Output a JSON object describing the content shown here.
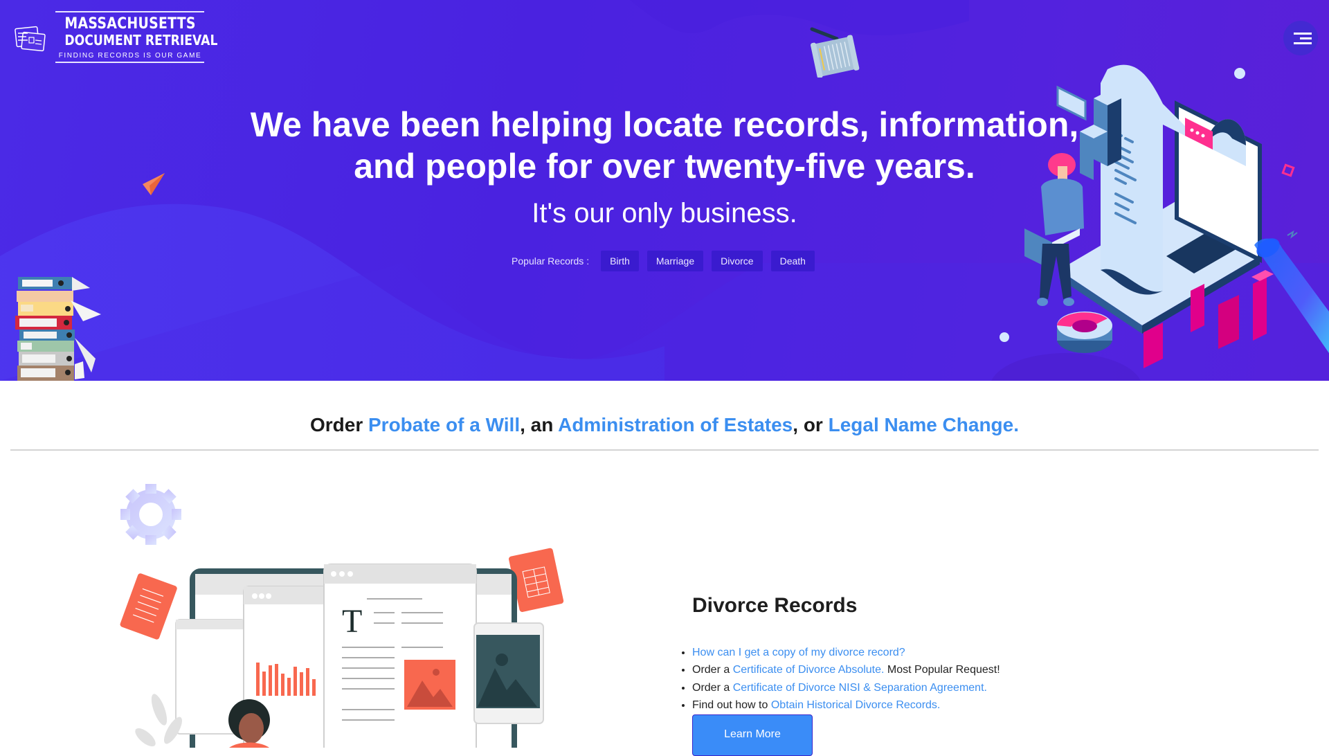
{
  "header": {
    "logo": {
      "line1": "MASSACHUSETTS",
      "line2": "DOCUMENT RETRIEVAL",
      "tagline": "FINDING RECORDS IS OUR GAME"
    },
    "menu_icon": "hamburger-menu-icon"
  },
  "hero": {
    "headline_line1": "We have been helping locate records, information,",
    "headline_line2": "and people for over twenty-five years.",
    "subheadline": "It's our only business.",
    "popular_label": "Popular Records :",
    "popular_records": [
      {
        "label": "Birth"
      },
      {
        "label": "Marriage"
      },
      {
        "label": "Divorce"
      },
      {
        "label": "Death"
      }
    ],
    "colors": {
      "background": "#4b24e2",
      "button_bg": "#3a1bcf"
    }
  },
  "order_banner": {
    "prefix": "Order ",
    "link1": "Probate of a Will",
    "sep1": ", an ",
    "link2": "Administration of Estates",
    "sep2": ", or ",
    "link3": "Legal Name Change."
  },
  "divorce_section": {
    "title": "Divorce Records",
    "items": [
      {
        "prefix": "",
        "link": "How can I get a copy of my divorce record?",
        "suffix": ""
      },
      {
        "prefix": "Order a ",
        "link": "Certificate of Divorce Absolute.",
        "suffix": " Most Popular Request!"
      },
      {
        "prefix": "Order a ",
        "link": "Certificate of Divorce NISI & Separation Agreement.",
        "suffix": ""
      },
      {
        "prefix": "Find out how to ",
        "link": "Obtain Historical Divorce Records.",
        "suffix": ""
      }
    ],
    "button_label": "Learn More",
    "colors": {
      "link": "#3b8ef0",
      "button": "#3a8cf8"
    }
  }
}
